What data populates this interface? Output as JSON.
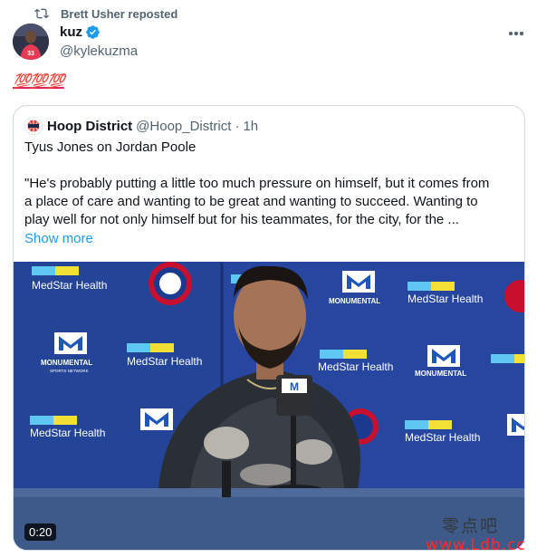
{
  "repost": {
    "icon": "repost-icon",
    "text": "Brett Usher reposted"
  },
  "author": {
    "name": "kuz",
    "handle": "@kylekuzma",
    "verified_icon": "verified-badge-icon",
    "avatar_icon": "avatar"
  },
  "more_icon": "more-horizontal-icon",
  "tweet": {
    "text": "💯💯💯"
  },
  "quote": {
    "avatar_icon": "hoop-district-logo",
    "name": "Hoop District",
    "handle": "@Hoop_District",
    "separator": "·",
    "time": "1h",
    "title": "Tyus Jones on Jordan Poole",
    "body_lines": [
      "\"He's probably putting a little too much pressure on himself, but it comes from",
      "a place of care and wanting to be great and wanting to succeed. Wanting to",
      "play well for not only himself but for his teammates, for the city, for the ..."
    ],
    "show_more": "Show more"
  },
  "media": {
    "duration": "0:20",
    "backdrop_labels": {
      "medstar": "MedStar Health",
      "monumental": "MONUMENTAL",
      "monumental_sub": "SPORTS NETWORK",
      "mic_flag": "M"
    }
  },
  "watermark": {
    "cn": "零点吧",
    "url": "www.Ldb.cc"
  },
  "colors": {
    "link": "#1d9bf0",
    "secondary_text": "#536471",
    "verified": "#1d9bf0",
    "backdrop": "#253a86",
    "border": "#cfd9de"
  }
}
